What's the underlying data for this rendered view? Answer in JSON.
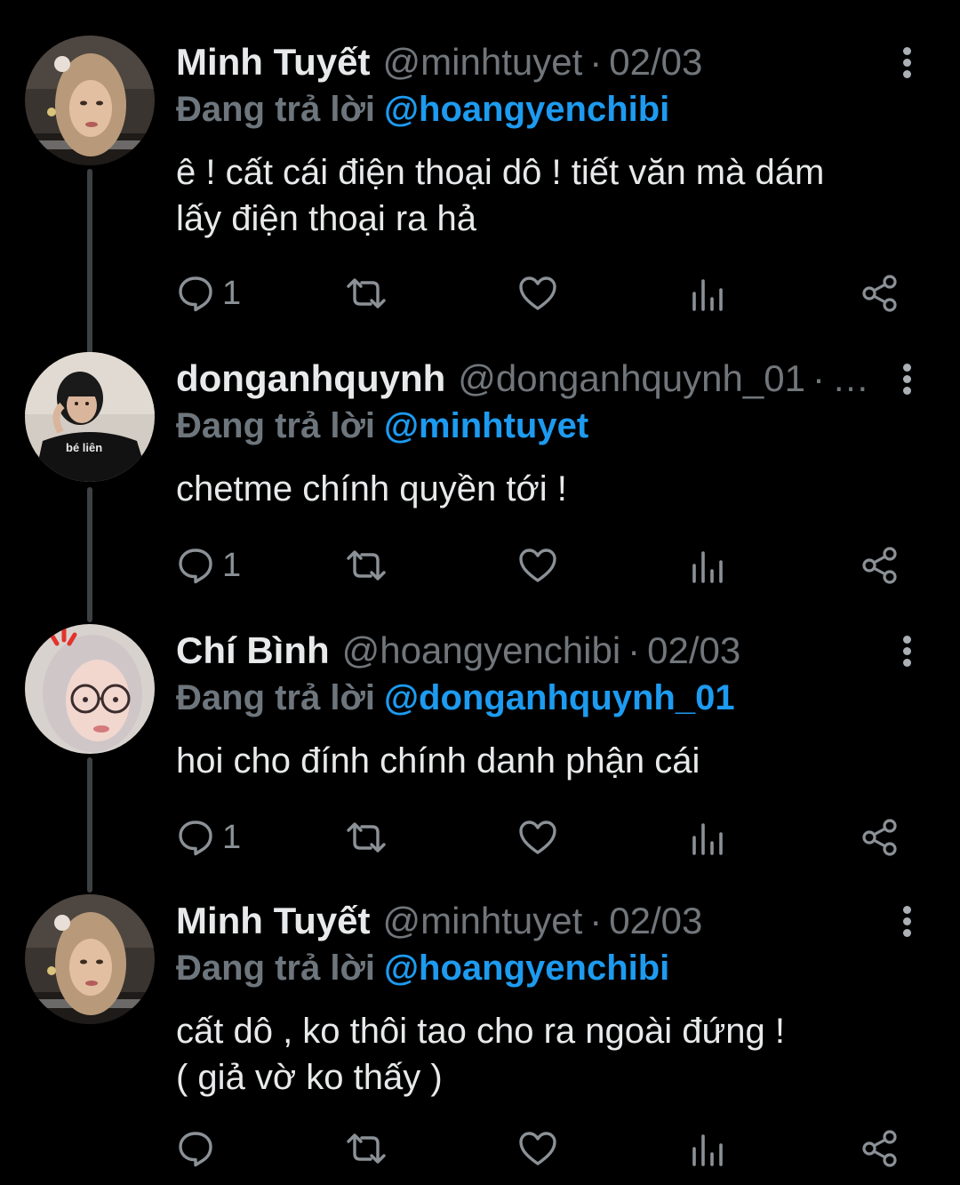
{
  "colors": {
    "background": "#000000",
    "text_primary": "#e7e9ea",
    "text_secondary": "#71767b",
    "mention": "#1d9bf0",
    "thread_line": "#3e4144"
  },
  "tweets": [
    {
      "display_name": "Minh Tuyết",
      "handle": "@minhtuyet",
      "separator": "·",
      "date": "02/03",
      "reply_label": "Đang trả lời",
      "reply_mention": "@hoangyenchibi",
      "lines": [
        "ê ! cất cái điện thoại dô ! tiết văn mà dám",
        "lấy điện thoại ra hả"
      ],
      "reply_count": "1",
      "avatar_icon": "avatar-photo-woman-blonde"
    },
    {
      "display_name": "donganhquynh",
      "handle": "@donganhquynh_01",
      "separator": "·",
      "date": "…",
      "reply_label": "Đang trả lời",
      "reply_mention": "@minhtuyet",
      "lines": [
        "chetme chính quyền tới !"
      ],
      "reply_count": "1",
      "avatar_icon": "avatar-photo-girl-black-shirt",
      "avatar_text": "bé liên"
    },
    {
      "display_name": "Chí Bình",
      "handle": "@hoangyenchibi",
      "separator": "·",
      "date": "02/03",
      "reply_label": "Đang trả lời",
      "reply_mention": "@donganhquynh_01",
      "lines": [
        "hoi cho đính chính danh phận cái"
      ],
      "reply_count": "1",
      "avatar_icon": "avatar-photo-girl-glasses"
    },
    {
      "display_name": "Minh Tuyết",
      "handle": "@minhtuyet",
      "separator": "·",
      "date": "02/03",
      "reply_label": "Đang trả lời",
      "reply_mention": "@hoangyenchibi",
      "lines": [
        "cất dô , ko thôi tao cho ra ngoài đứng !",
        "( giả vờ ko thấy )"
      ],
      "reply_count": "",
      "avatar_icon": "avatar-photo-woman-blonde"
    }
  ],
  "action_icons": [
    "reply-icon",
    "retweet-icon",
    "like-icon",
    "views-icon",
    "share-icon"
  ]
}
